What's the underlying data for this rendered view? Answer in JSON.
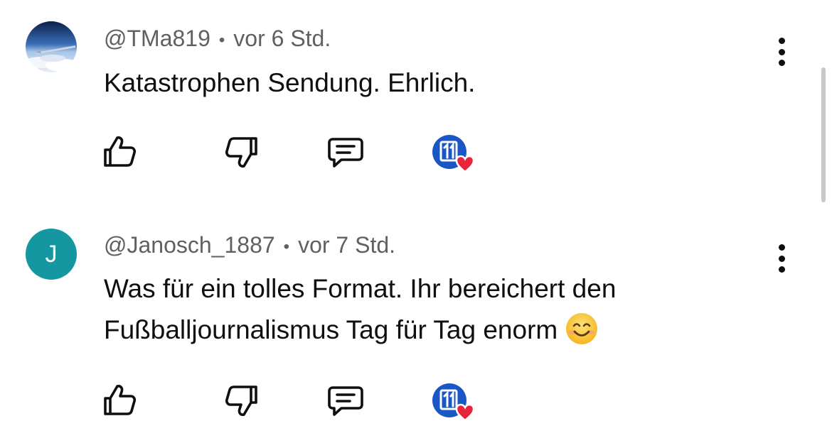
{
  "comments": [
    {
      "handle": "@TMa819",
      "separator": "•",
      "time": "vor 6 Std.",
      "lines": [
        "Katastrophen Sendung. Ehrlich."
      ],
      "avatar_type": "photo",
      "avatar_icon": "airplane-wing-sky"
    },
    {
      "handle": "@Janosch_1887",
      "separator": "•",
      "time": "vor 7 Std.",
      "lines": [
        "Was für ein tolles Format. Ihr bereichert den",
        "Fußballjournalismus Tag für Tag enorm"
      ],
      "avatar_type": "letter",
      "avatar_letter": "J",
      "avatar_color": "#1497a0",
      "trailing_emoji": "smiling-face-emoji"
    }
  ],
  "action_icons": [
    "like-icon",
    "dislike-icon",
    "reply-icon",
    "creator-heart-icon"
  ],
  "creator_badge_color": "#1a56c4",
  "heart_color": "#e8243c"
}
